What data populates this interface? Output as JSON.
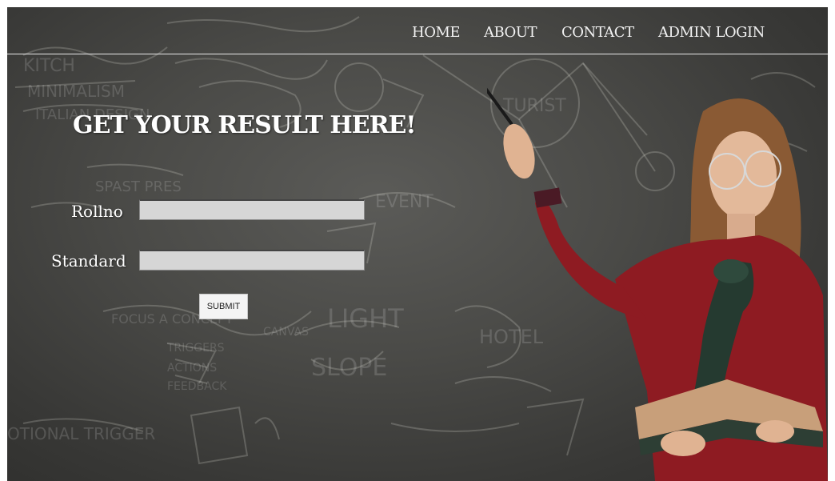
{
  "nav": {
    "links": [
      {
        "label": "HOME"
      },
      {
        "label": "ABOUT"
      },
      {
        "label": "CONTACT"
      },
      {
        "label": "ADMIN LOGIN"
      }
    ]
  },
  "hero": {
    "title": "GET YOUR RESULT HERE!"
  },
  "form": {
    "rollno_label": "Rollno",
    "rollno_value": "",
    "standard_label": "Standard",
    "standard_value": "",
    "submit_label": "SUBMIT"
  },
  "background": {
    "board_color": "#4a4a47",
    "nav_line_color": "#e8e8e8",
    "input_color": "#d6d6d6"
  }
}
